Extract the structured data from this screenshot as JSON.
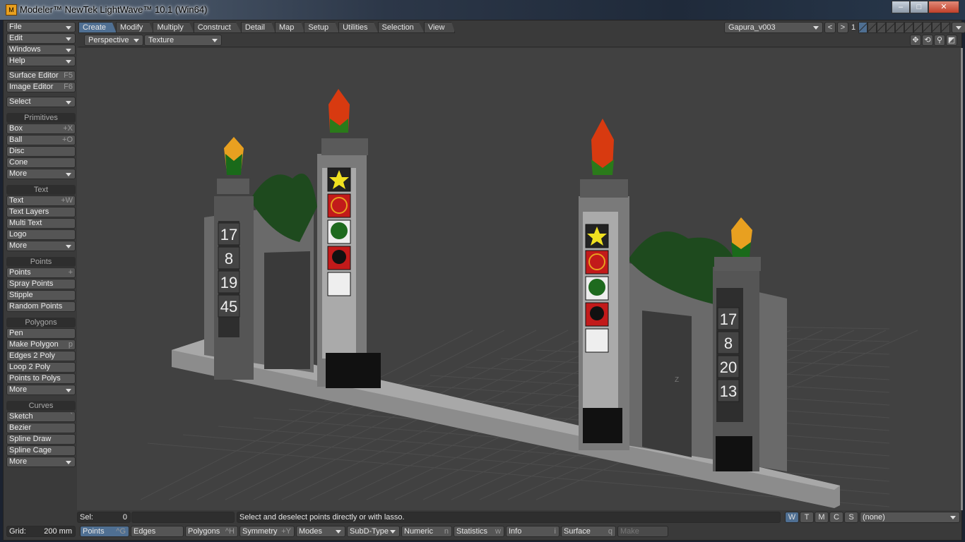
{
  "window": {
    "title": "Modeler™ NewTek LightWave™ 10.1 (Win64)",
    "icon": "M",
    "minimize": "–",
    "maximize": "□",
    "close": "✕"
  },
  "sidebar": {
    "menus": [
      {
        "label": "File"
      },
      {
        "label": "Edit"
      },
      {
        "label": "Windows"
      },
      {
        "label": "Help"
      }
    ],
    "editors": [
      {
        "label": "Surface Editor",
        "shortcut": "F5"
      },
      {
        "label": "Image Editor",
        "shortcut": "F6"
      }
    ],
    "select": "Select",
    "groups": [
      {
        "title": "Primitives",
        "items": [
          {
            "label": "Box",
            "shortcut": "+X"
          },
          {
            "label": "Ball",
            "shortcut": "+O"
          },
          {
            "label": "Disc",
            "shortcut": ""
          },
          {
            "label": "Cone",
            "shortcut": ""
          },
          {
            "label": "More",
            "dropdown": true
          }
        ]
      },
      {
        "title": "Text",
        "items": [
          {
            "label": "Text",
            "shortcut": "+W"
          },
          {
            "label": "Text Layers",
            "shortcut": ""
          },
          {
            "label": "Multi Text",
            "shortcut": ""
          },
          {
            "label": "Logo",
            "shortcut": ""
          },
          {
            "label": "More",
            "dropdown": true
          }
        ]
      },
      {
        "title": "Points",
        "items": [
          {
            "label": "Points",
            "shortcut": "+"
          },
          {
            "label": "Spray Points",
            "shortcut": ""
          },
          {
            "label": "Stipple",
            "shortcut": ""
          },
          {
            "label": "Random Points",
            "shortcut": ""
          }
        ]
      },
      {
        "title": "Polygons",
        "items": [
          {
            "label": "Pen",
            "shortcut": ""
          },
          {
            "label": "Make Polygon",
            "shortcut": "p"
          },
          {
            "label": "Edges 2 Poly",
            "shortcut": ""
          },
          {
            "label": "Loop 2 Poly",
            "shortcut": ""
          },
          {
            "label": "Points to Polys",
            "shortcut": ""
          },
          {
            "label": "More",
            "dropdown": true
          }
        ]
      },
      {
        "title": "Curves",
        "items": [
          {
            "label": "Sketch",
            "shortcut": "`"
          },
          {
            "label": "Bezier",
            "shortcut": ""
          },
          {
            "label": "Spline Draw",
            "shortcut": ""
          },
          {
            "label": "Spline Cage",
            "shortcut": ""
          },
          {
            "label": "More",
            "dropdown": true
          }
        ]
      }
    ]
  },
  "tabs": [
    {
      "label": "Create",
      "active": true
    },
    {
      "label": "Modify"
    },
    {
      "label": "Multiply"
    },
    {
      "label": "Construct"
    },
    {
      "label": "Detail"
    },
    {
      "label": "Map"
    },
    {
      "label": "Setup"
    },
    {
      "label": "Utilities"
    },
    {
      "label": "Selection"
    },
    {
      "label": "View"
    }
  ],
  "object": {
    "name": "Gapura_v003",
    "layer": "1",
    "prev": "<",
    "next": ">"
  },
  "viewport": {
    "view": "Perspective",
    "render": "Texture",
    "axis_label": "Z",
    "icons": [
      "move-icon",
      "rotate-icon",
      "zoom-icon",
      "maximize-icon"
    ],
    "pillar_numbers_left": [
      "17",
      "8",
      "19",
      "45"
    ],
    "pillar_numbers_right": [
      "17",
      "8",
      "20",
      "13"
    ]
  },
  "status": {
    "sel_label": "Sel:",
    "sel_value": "0",
    "message": "Select and deselect points directly or with lasso.",
    "wtmcs": [
      "W",
      "T",
      "M",
      "C",
      "S"
    ],
    "active_wtmcs": "W",
    "vmap": "(none)"
  },
  "bottom": {
    "grid_label": "Grid:",
    "grid_value": "200 mm",
    "items": [
      {
        "label": "Points",
        "shortcut": "^G",
        "active": true
      },
      {
        "label": "Edges",
        "shortcut": ""
      },
      {
        "label": "Polygons",
        "shortcut": "^H"
      },
      {
        "label": "Symmetry",
        "shortcut": "+Y"
      },
      {
        "label": "Modes",
        "dropdown": true
      },
      {
        "label": "SubD-Type",
        "dropdown": true
      },
      {
        "label": "Numeric",
        "shortcut": "n"
      },
      {
        "label": "Statistics",
        "shortcut": "w"
      },
      {
        "label": "Info",
        "shortcut": "i"
      },
      {
        "label": "Surface",
        "shortcut": "q"
      },
      {
        "label": "Make",
        "disabled": true
      }
    ]
  },
  "colors": {
    "accent": "#4f6f92",
    "panel": "#3a3a3a",
    "button": "#555555",
    "viewport": "#414141"
  }
}
